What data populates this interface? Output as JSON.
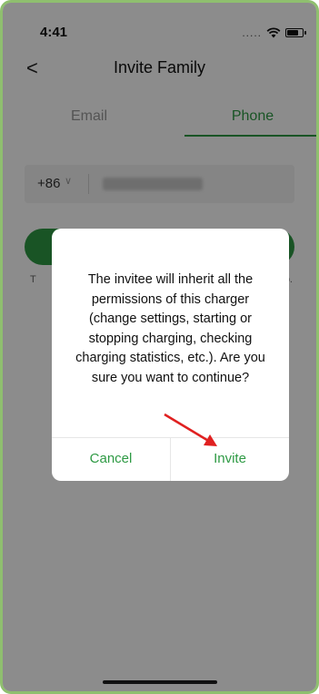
{
  "status_bar": {
    "time": "4:41",
    "signal": "....."
  },
  "nav": {
    "back": "<",
    "title": "Invite Family"
  },
  "tabs": [
    {
      "label": "Email",
      "active": false
    },
    {
      "label": "Phone",
      "active": true
    }
  ],
  "phone_input": {
    "country_code": "+86",
    "chevron": "∨"
  },
  "hint": {
    "left": "T",
    "right": "o."
  },
  "dialog": {
    "message": "The invitee will inherit all the permissions of this charger (change settings, starting or stopping charging, checking charging statistics, etc.). Are you sure you want to continue?",
    "cancel_label": "Cancel",
    "invite_label": "Invite"
  },
  "colors": {
    "accent": "#2e9a44",
    "annotation_arrow": "#e02020"
  }
}
